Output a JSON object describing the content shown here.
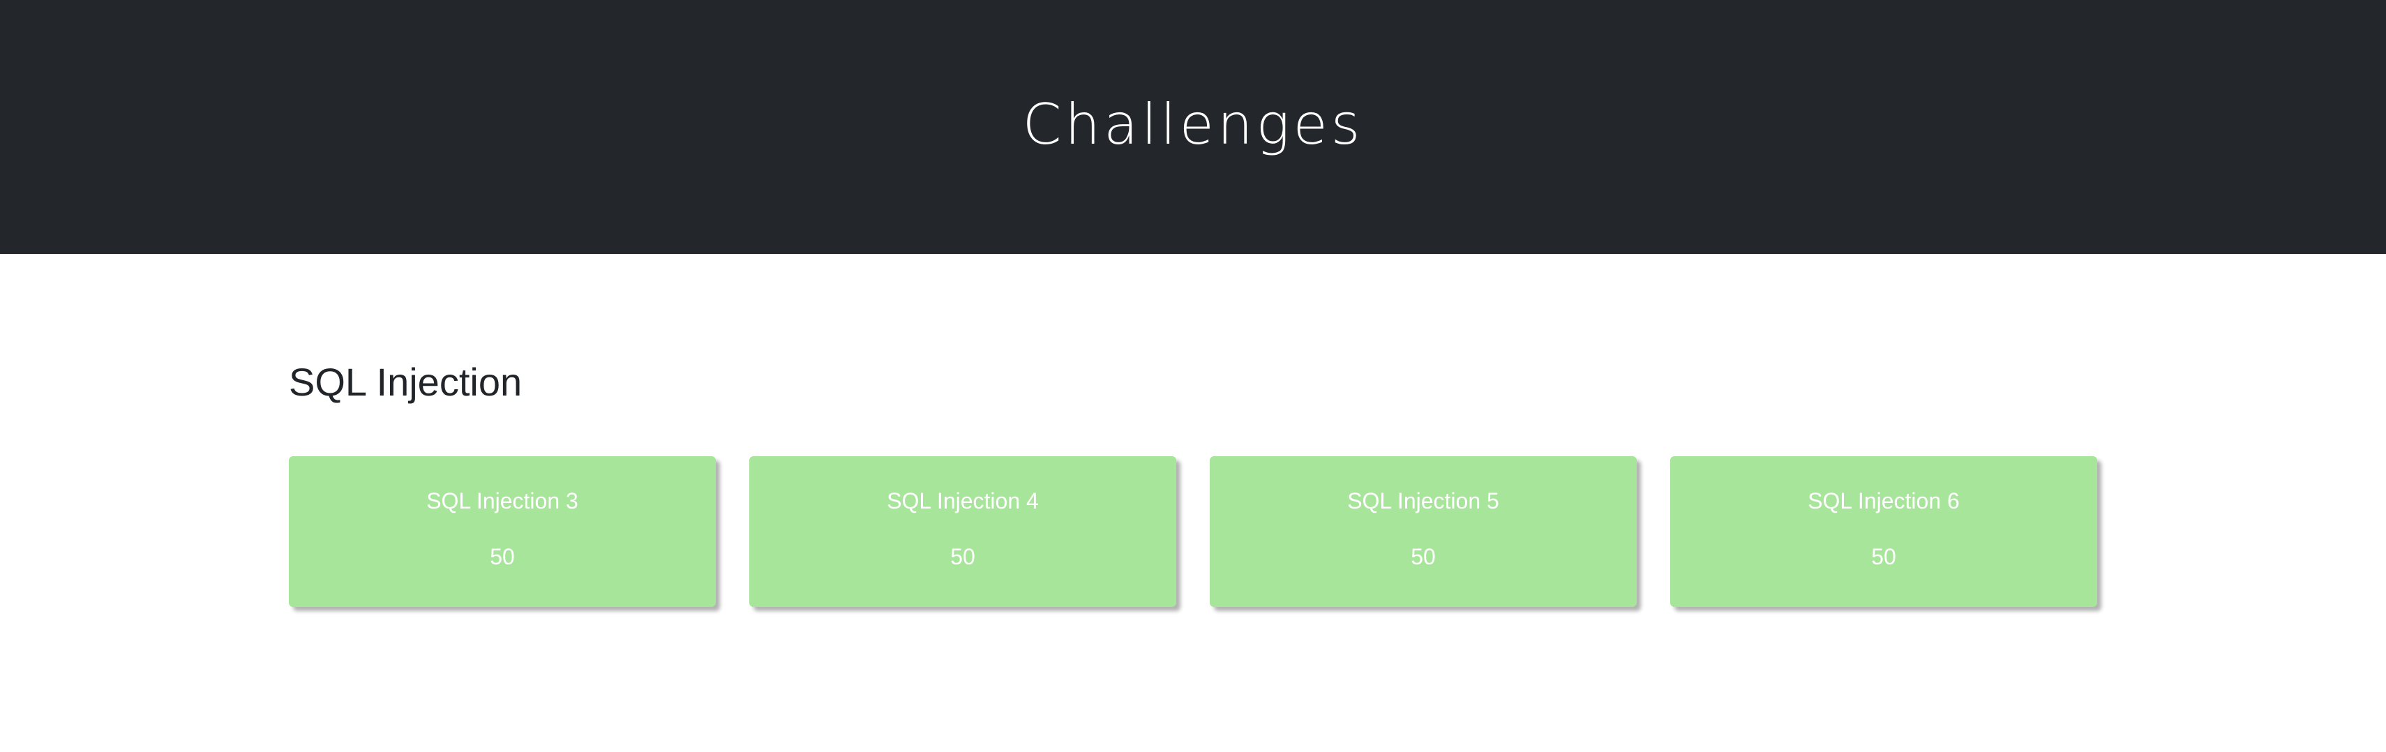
{
  "header": {
    "title": "Challenges"
  },
  "category": {
    "name": "SQL Injection",
    "challenges": [
      {
        "name": "SQL Injection 3",
        "value": "50"
      },
      {
        "name": "SQL Injection 4",
        "value": "50"
      },
      {
        "name": "SQL Injection 5",
        "value": "50"
      },
      {
        "name": "SQL Injection 6",
        "value": "50"
      }
    ]
  },
  "colors": {
    "header_bg": "#23262b",
    "solved_card": "#a7e59a",
    "card_text": "#ffffff"
  }
}
